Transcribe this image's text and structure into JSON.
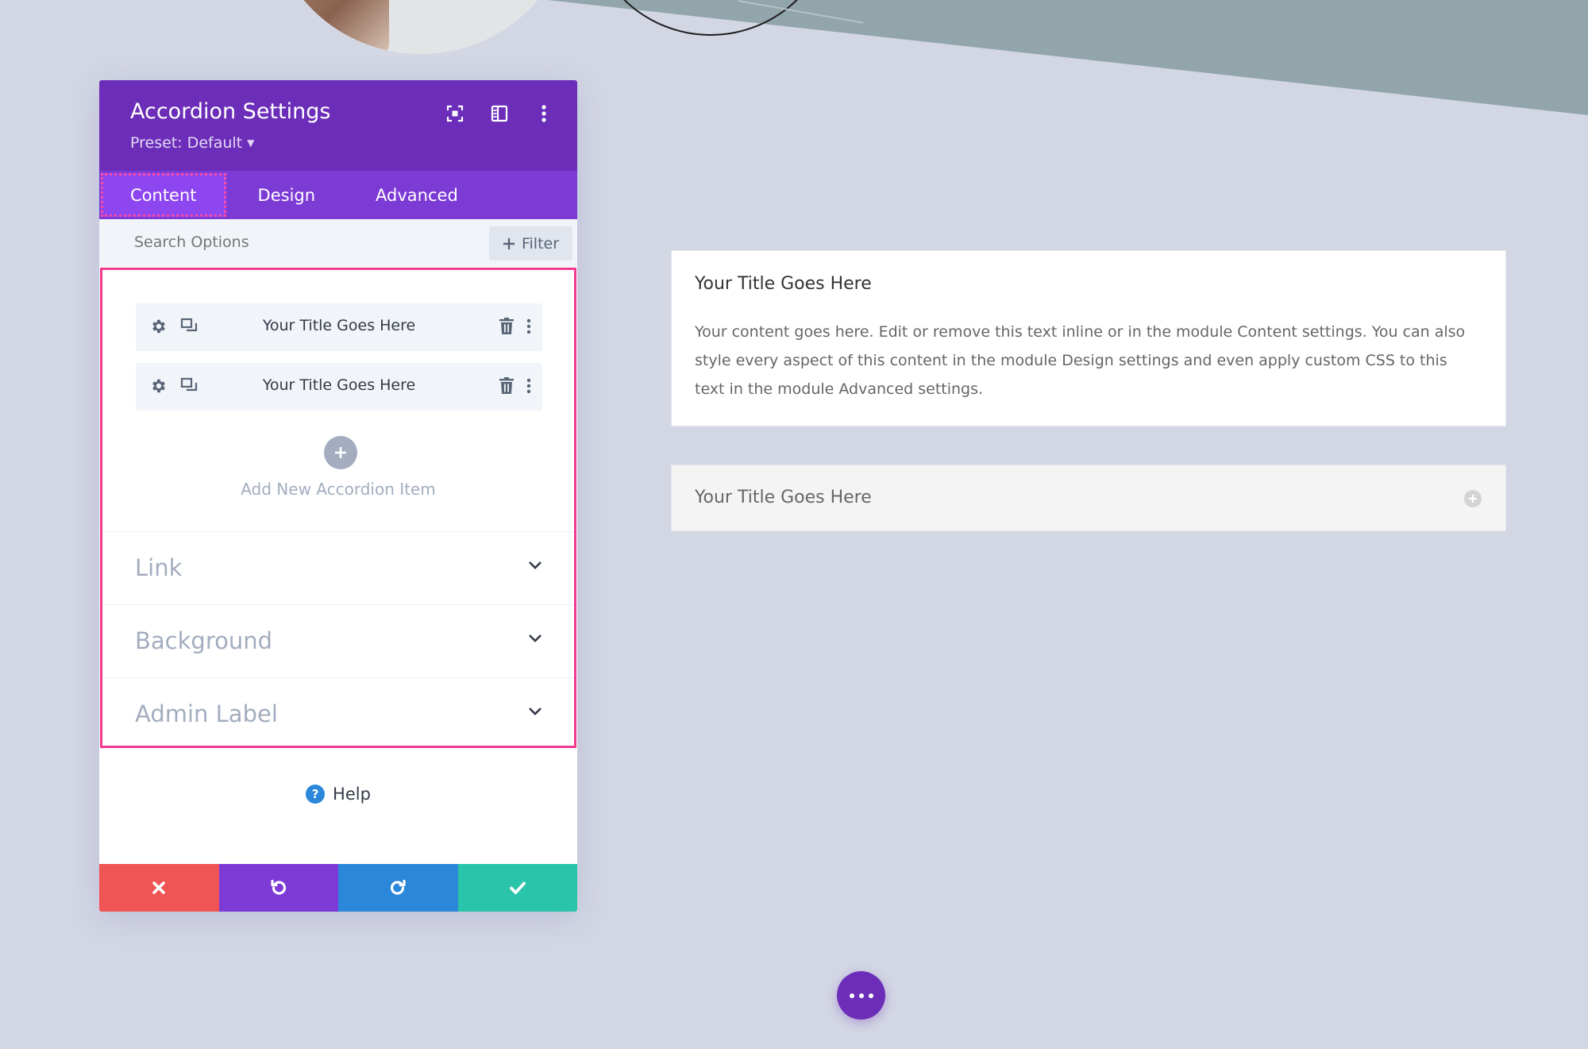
{
  "panel": {
    "title": "Accordion Settings",
    "preset_label": "Preset: Default",
    "header_icons": [
      "fullscreen-icon",
      "split-view-icon",
      "more-options-icon"
    ],
    "tabs": [
      {
        "label": "Content",
        "active": true
      },
      {
        "label": "Design",
        "active": false
      },
      {
        "label": "Advanced",
        "active": false
      }
    ],
    "search": {
      "placeholder": "Search Options",
      "value": ""
    },
    "filter_label": "Filter",
    "accordion_items": [
      {
        "title": "Your Title Goes Here"
      },
      {
        "title": "Your Title Goes Here"
      }
    ],
    "add_item_label": "Add New Accordion Item",
    "toggles": [
      {
        "label": "Link"
      },
      {
        "label": "Background"
      },
      {
        "label": "Admin Label"
      }
    ],
    "help_label": "Help",
    "actions": [
      "cancel-icon",
      "undo-icon",
      "redo-icon",
      "save-icon"
    ]
  },
  "preview": {
    "open_item": {
      "title": "Your Title Goes Here",
      "body": "Your content goes here. Edit or remove this text inline or in the module Content settings. You can also style every aspect of this content in the module Design settings and even apply custom CSS to this text in the module Advanced settings."
    },
    "closed_item": {
      "title": "Your Title Goes Here"
    }
  },
  "colors": {
    "header": "#6c2eb9",
    "tabs": "#7d3bd6",
    "active_tab": "#8d46f0",
    "highlight": "#f0398f",
    "cancel": "#ef5555",
    "undo": "#7d3bd6",
    "redo": "#2b87da",
    "save": "#29c4a9",
    "background": "#d3d7e4"
  }
}
